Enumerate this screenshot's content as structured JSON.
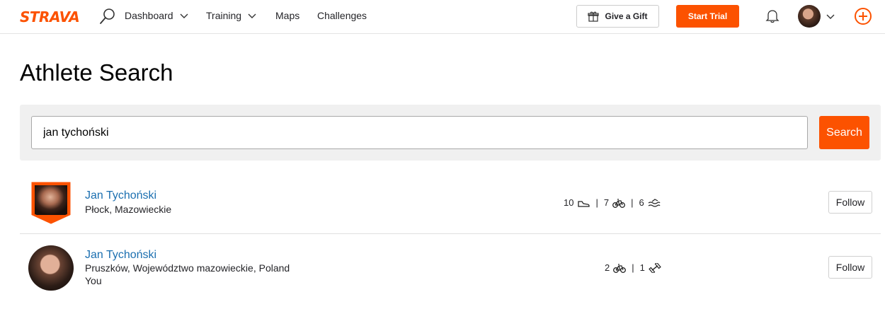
{
  "nav": {
    "logo": "STRAVA",
    "items": [
      {
        "label": "Dashboard",
        "has_chevron": true
      },
      {
        "label": "Training",
        "has_chevron": true
      },
      {
        "label": "Maps",
        "has_chevron": false
      },
      {
        "label": "Challenges",
        "has_chevron": false
      }
    ],
    "gift_label": "Give a Gift",
    "trial_label": "Start Trial",
    "accent_color": "#fc5200"
  },
  "page": {
    "title": "Athlete Search"
  },
  "search": {
    "value": "jan tychoński",
    "button_label": "Search"
  },
  "results": [
    {
      "name": "Jan Tychoński",
      "location": "Płock, Mazowieckie",
      "you_label": "",
      "avatar": "badge-avatar",
      "stats": [
        {
          "count": "10",
          "icon": "shoe-icon"
        },
        {
          "count": "7",
          "icon": "bike-icon"
        },
        {
          "count": "6",
          "icon": "swim-icon"
        }
      ],
      "follow_label": "Follow"
    },
    {
      "name": "Jan Tychoński",
      "location": "Pruszków, Województwo mazowieckie, Poland",
      "you_label": "You",
      "avatar": "round-avatar",
      "stats": [
        {
          "count": "2",
          "icon": "bike-icon"
        },
        {
          "count": "1",
          "icon": "dumbbell-icon"
        }
      ],
      "follow_label": "Follow"
    }
  ]
}
